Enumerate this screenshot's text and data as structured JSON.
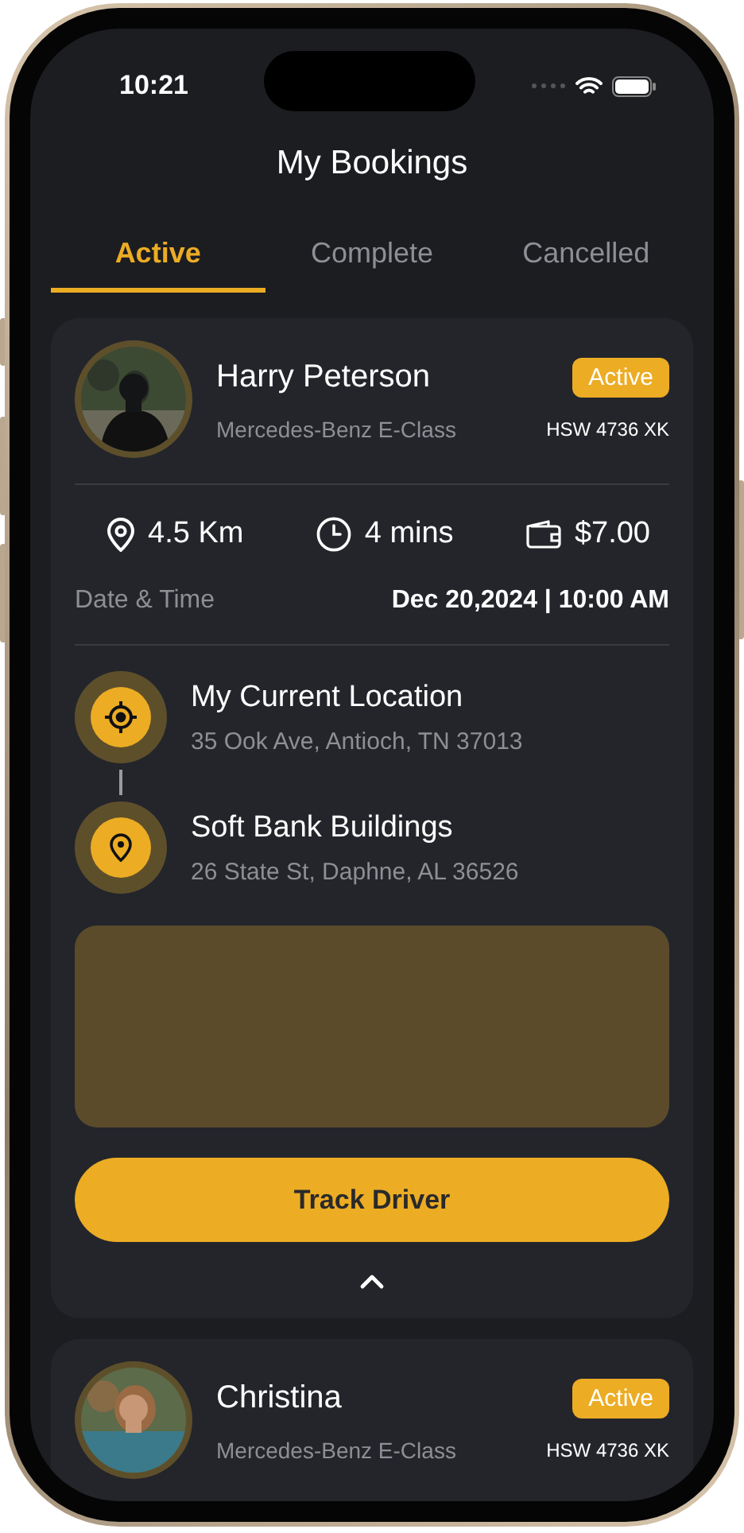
{
  "status_bar": {
    "time": "10:21"
  },
  "header": {
    "title": "My Bookings"
  },
  "tabs": [
    {
      "label": "Active",
      "selected": true
    },
    {
      "label": "Complete",
      "selected": false
    },
    {
      "label": "Cancelled",
      "selected": false
    }
  ],
  "bookings": [
    {
      "driver": "Harry Peterson",
      "status": "Active",
      "vehicle": "Mercedes-Benz E-Class",
      "plate": "HSW 4736 XK",
      "expanded": true,
      "distance": "4.5 Km",
      "duration": "4 mins",
      "fare": "$7.00",
      "date_label": "Date & Time",
      "date_value": "Dec 20,2024 | 10:00 AM",
      "pickup": {
        "title": "My Current Location",
        "address": "35 Ook Ave, Antioch, TN 37013"
      },
      "dropoff": {
        "title": "Soft Bank Buildings",
        "address": "26 State St, Daphne, AL 36526"
      },
      "action": "Track Driver"
    },
    {
      "driver": "Christina",
      "status": "Active",
      "vehicle": "Mercedes-Benz E-Class",
      "plate": "HSW 4736 XK",
      "expanded": false
    }
  ]
}
